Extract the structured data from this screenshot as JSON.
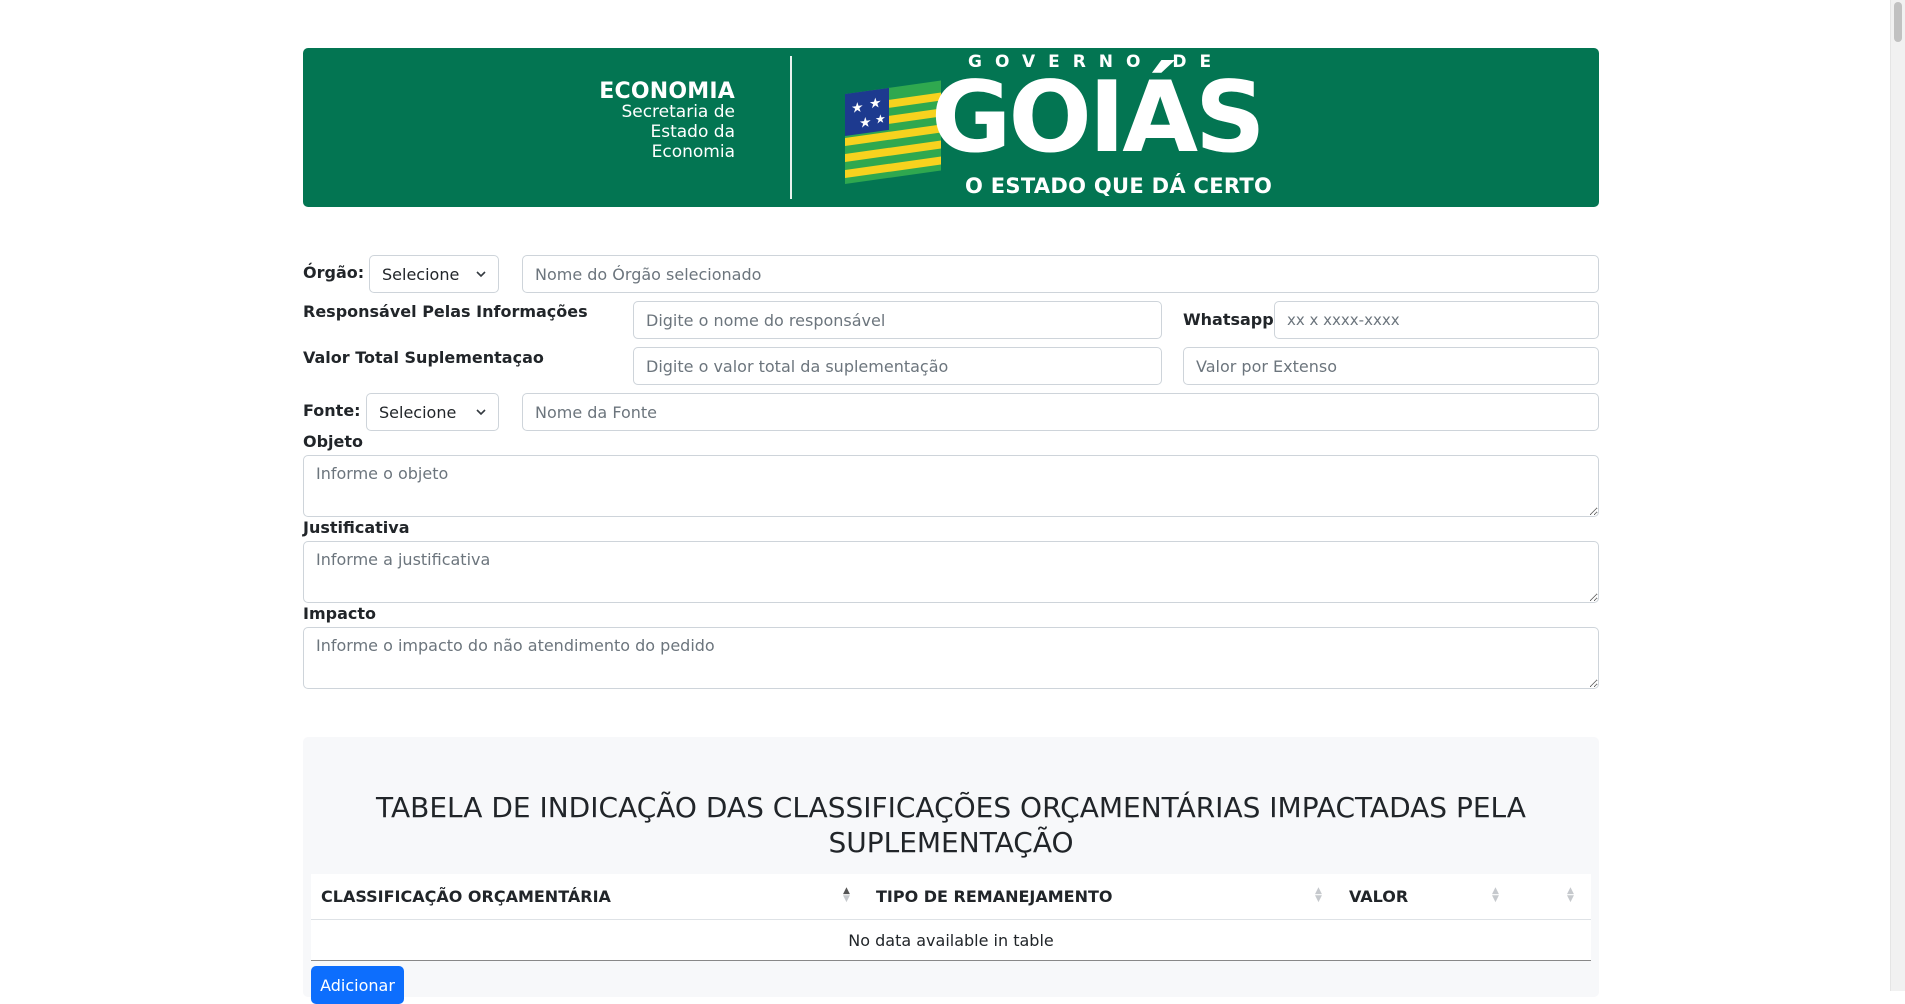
{
  "banner": {
    "secretaria_title": "ECONOMIA",
    "secretaria_lines": [
      "Secretaria de",
      "Estado da",
      "Economia"
    ],
    "gov_top": "GOVERNO DE",
    "state": "GOIÁS",
    "slogan": "O ESTADO QUE DÁ CERTO",
    "colors": {
      "brand_green": "#037552",
      "flag_yellow": "#f7d21e",
      "flag_blue": "#1d3a8f",
      "flag_green": "#2fa84f"
    }
  },
  "form": {
    "orgao": {
      "label": "Órgão:",
      "select_value": "Selecione",
      "name_placeholder": "Nome do Órgão selecionado"
    },
    "responsavel": {
      "label": "Responsável Pelas Informações",
      "placeholder": "Digite o nome do responsável"
    },
    "whatsapp": {
      "label": "Whatsapp",
      "placeholder": "xx x xxxx-xxxx"
    },
    "valor": {
      "label": "Valor Total Suplementaçao",
      "placeholder": "Digite o valor total da suplementação",
      "extenso_placeholder": "Valor por Extenso"
    },
    "fonte": {
      "label": "Fonte:",
      "select_value": "Selecione",
      "name_placeholder": "Nome da Fonte"
    },
    "objeto": {
      "label": "Objeto",
      "placeholder": "Informe o objeto"
    },
    "justificativa": {
      "label": "Justificativa",
      "placeholder": "Informe a justificativa"
    },
    "impacto": {
      "label": "Impacto",
      "placeholder": "Informe o impacto do não atendimento do pedido"
    }
  },
  "table": {
    "title": "TABELA DE INDICAÇÃO DAS CLASSIFICAÇÕES ORÇAMENTÁRIAS IMPACTADAS PELA SUPLEMENTAÇÃO",
    "columns": [
      "CLASSIFICAÇÃO ORÇAMENTÁRIA",
      "TIPO DE REMANEJAMENTO",
      "VALOR",
      ""
    ],
    "empty_message": "No data available in table",
    "add_button": "Adicionar"
  }
}
